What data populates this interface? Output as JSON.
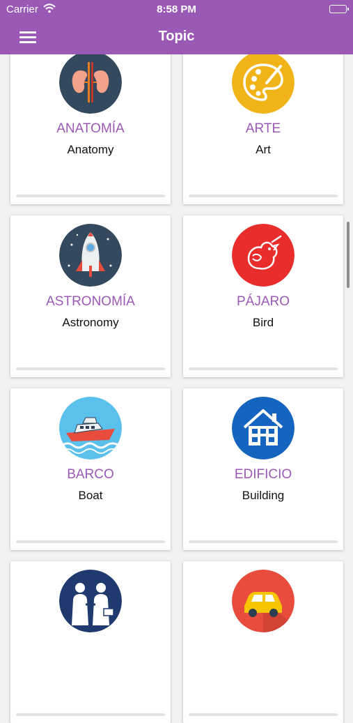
{
  "status_bar": {
    "carrier": "Carrier",
    "time": "8:58 PM"
  },
  "nav": {
    "title": "Topic"
  },
  "colors": {
    "accent": "#9b59b6",
    "card_background": "#ffffff",
    "page_background": "#f2f2f2"
  },
  "topics": [
    {
      "title": "ANATOMÍA",
      "subtitle": "Anatomy",
      "icon": "kidneys-icon",
      "progress": 0
    },
    {
      "title": "ARTE",
      "subtitle": "Art",
      "icon": "palette-icon",
      "progress": 0
    },
    {
      "title": "ASTRONOMÍA",
      "subtitle": "Astronomy",
      "icon": "rocket-icon",
      "progress": 0
    },
    {
      "title": "PÁJARO",
      "subtitle": "Bird",
      "icon": "bird-icon",
      "progress": 0
    },
    {
      "title": "BARCO",
      "subtitle": "Boat",
      "icon": "boat-icon",
      "progress": 0
    },
    {
      "title": "EDIFICIO",
      "subtitle": "Building",
      "icon": "house-icon",
      "progress": 0
    },
    {
      "title": "",
      "subtitle": "",
      "icon": "business-handshake-icon",
      "progress": 0
    },
    {
      "title": "",
      "subtitle": "",
      "icon": "car-icon",
      "progress": 0
    }
  ]
}
